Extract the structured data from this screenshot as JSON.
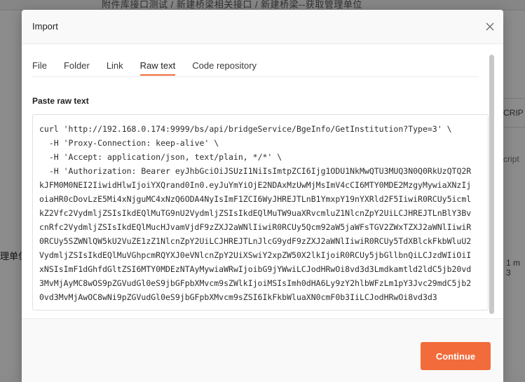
{
  "background": {
    "tabs_text": "附件库接口测试 / 新建桥梁相关接口 / 新建桥梁--获取管理单位",
    "left_text": "理单位",
    "right_text_1": "CRIP",
    "right_text_2": "cript",
    "right_text_3": "1 m 3"
  },
  "modal": {
    "title": "Import",
    "close_icon": "close-icon",
    "tabs": [
      {
        "label": "File"
      },
      {
        "label": "Folder"
      },
      {
        "label": "Link"
      },
      {
        "label": "Raw text",
        "active": true
      },
      {
        "label": "Code repository"
      }
    ],
    "section_label": "Paste raw text",
    "raw_text": "curl 'http://192.168.0.174:9999/bs/api/bridgeService/BgeInfo/GetInstitution?Type=3' \\\n  -H 'Proxy-Connection: keep-alive' \\\n  -H 'Accept: application/json, text/plain, */*' \\\n  -H 'Authorization: Bearer eyJhbGciOiJSUzI1NiIsImtpZCI6Ijg1ODU1NkMwQTU3MUQ3N0Q0RkUzQTQ2RkJFM0M0NEI2IiwidHlwIjoiYXQrand0In0.eyJuYmYiOjE2NDAxMzUwMjMsImV4cCI6MTY0MDE2MzgyMywiaXNzIjoiaHR0cDovLzE5Mi4xNjguMC4xNzQ6ODA4NyIsImF1ZCI6WyJHREJTLnB1YmxpY19nYXRld2F5IiwiR0RCUy5icmlkZ2Vfc2VydmljZSIsIkdEQlMuTG9nU2VydmljZSIsIkdEQlMuTW9uaXRvcmluZ1NlcnZpY2UiLCJHREJTLnBlY3BvcnRfc2VydmljZSIsIkdEQlMucHJvamVjdF9zZXJ2aWNlIiwiR0RCUy5Qcm92aW5jaWFsTGV2ZWxTZXJ2aWNlIiwiR0RCUy5SZWNlQW5kU2VuZE1zZ1NlcnZpY2UiLCJHREJTLnJlcG9ydF9zZXJ2aWNlIiwiR0RCUy5TdXBlckFkbWluU2VydmljZSIsIkdEQlMuVGhpcmRQYXJ0eVNlcnZpY2UiXSwiY2xpZW50X2lkIjoiR0RCUy5jbGllbnQiLCJzdWIiOiIxNSIsImF1dGhfdGltZSI6MTY0MDEzNTAyMywiaWRwIjoibG9jYWwiLCJodHRwOi8vd3d3Lmdkamtld2ldC5jb20vd3MvMjAyMC8wOS9pZGVudGl0eS9jbGFpbXMvcm9sZWlkIjoiMSIsImh0dHA6Ly9zY2hlbWFzLm1pY3Jvc29mdC5jb20vd3MvMjAwOC8wNi9pZGVudGl0eS9jbGFpbXMvcm9sZSI6IkFkbWluaXN0cmF0b3IiLCJodHRwOi8vd3d3",
    "continue_label": "Continue"
  },
  "colors": {
    "accent": "#f26b3a"
  }
}
